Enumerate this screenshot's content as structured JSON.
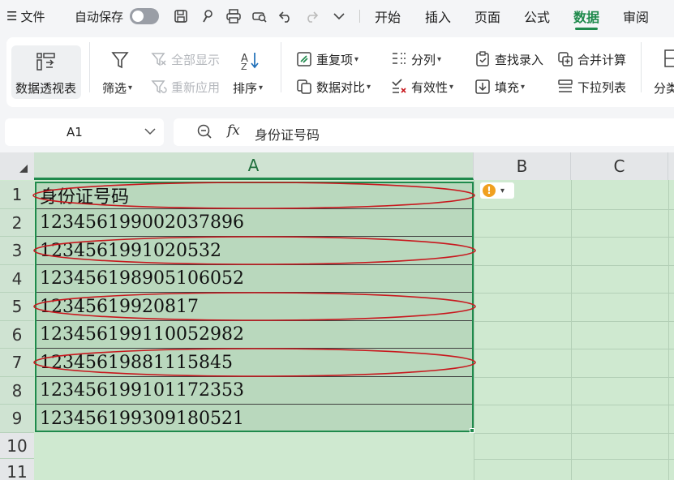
{
  "menu": {
    "app_menu_label": "文件",
    "autosave_label": "自动保存",
    "tabs": [
      "开始",
      "插入",
      "页面",
      "公式",
      "数据",
      "审阅"
    ],
    "active_tab": "数据"
  },
  "ribbon": {
    "pivot_label": "数据透视表",
    "filter_label": "筛选",
    "show_all_label": "全部显示",
    "reapply_label": "重新应用",
    "sort_label": "排序",
    "duplicates_label": "重复项",
    "compare_label": "数据对比",
    "split_label": "分列",
    "validity_label": "有效性",
    "lookup_entry_label": "查找录入",
    "fill_label": "填充",
    "merge_calc_label": "合并计算",
    "dropdown_list_label": "下拉列表",
    "group_label": "分类"
  },
  "formula_bar": {
    "cell_ref": "A1",
    "fx_label": "fx",
    "content": "身份证号码"
  },
  "sheet": {
    "columns": [
      "A",
      "B",
      "C"
    ],
    "selected_column": "A",
    "row_numbers": [
      "1",
      "2",
      "3",
      "4",
      "5",
      "6",
      "7",
      "8",
      "9",
      "10",
      "11"
    ],
    "cells_A": [
      "身份证号码",
      "123456199002037896",
      "1234561991020532",
      "123456198905106052",
      "12345619920817",
      "123456199110052982",
      "12345619881115845",
      "123456199101172353",
      "123456199309180521"
    ],
    "highlighted_rows": [
      1,
      3,
      5,
      7
    ],
    "annotation_color": "#c8181e",
    "selection_color": "#1f8a4c"
  }
}
